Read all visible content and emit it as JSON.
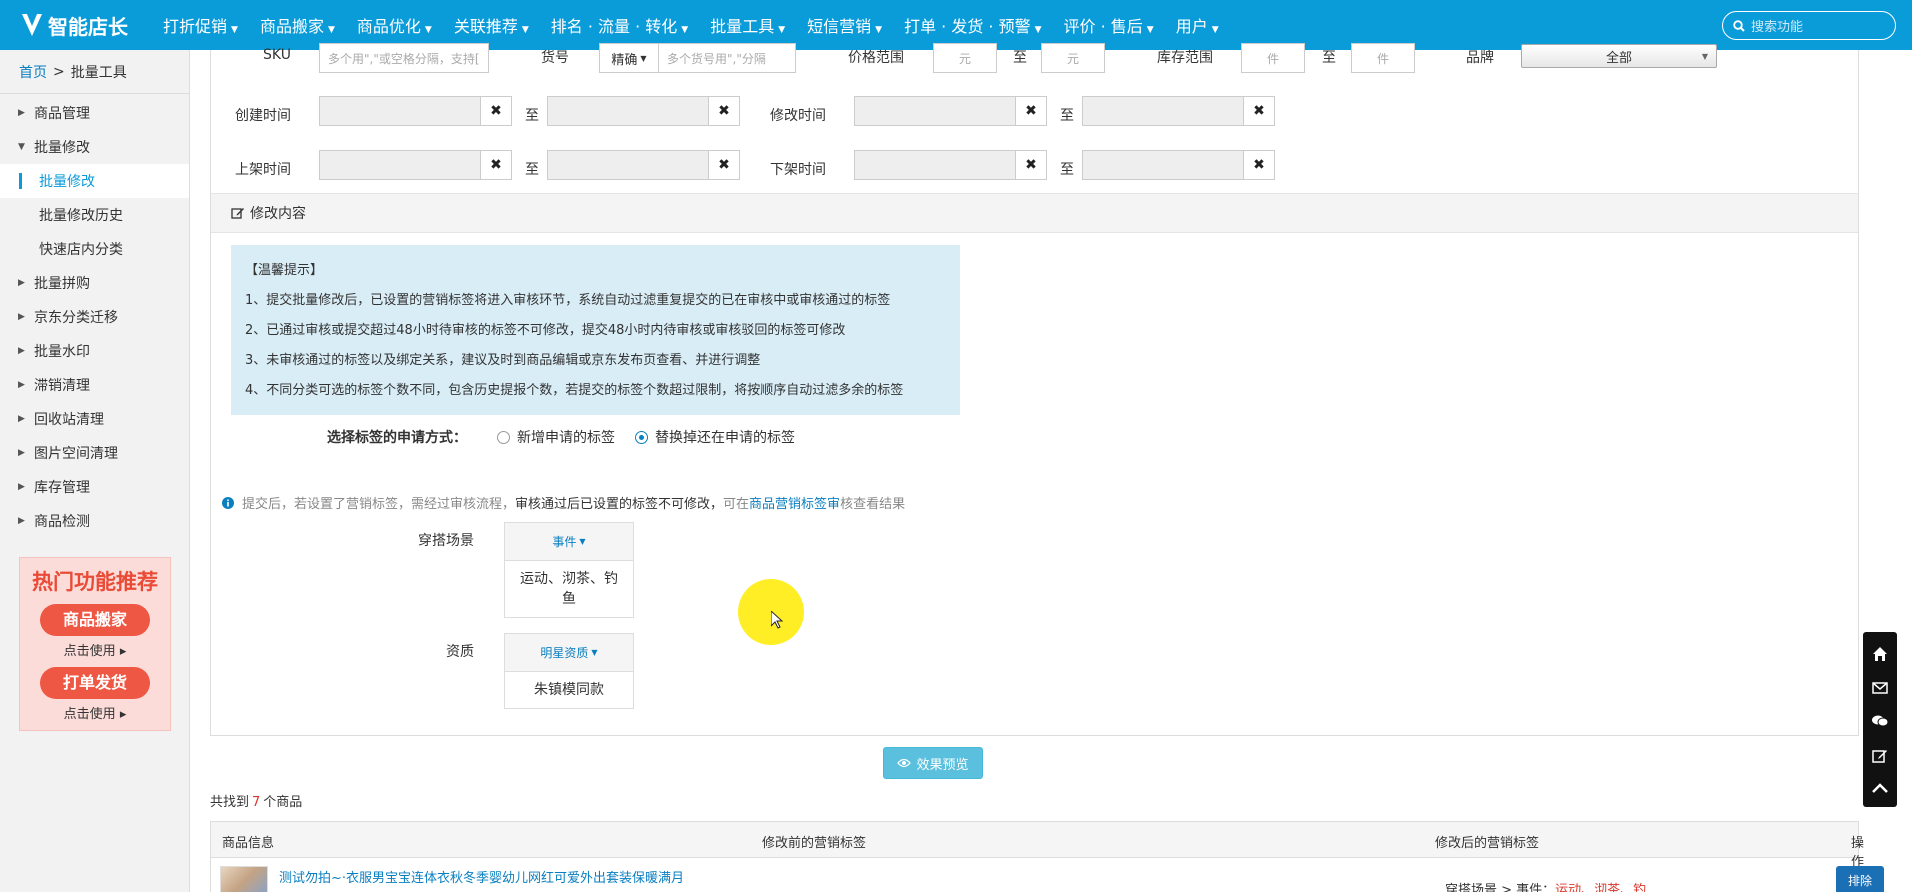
{
  "brand": {
    "name": "智能店长"
  },
  "nav": [
    "打折促销",
    "商品搬家",
    "商品优化",
    "关联推荐",
    "排名 · 流量 · 转化",
    "批量工具",
    "短信营销",
    "打单 · 发货 · 预警",
    "评价 · 售后",
    "用户"
  ],
  "search": {
    "placeholder": "搜索功能"
  },
  "breadcrumb": {
    "home": "首页",
    "sep": ">",
    "current": "批量工具"
  },
  "sidebar": {
    "items": [
      {
        "label": "商品管理"
      },
      {
        "label": "批量修改"
      },
      {
        "label": "批量修改"
      },
      {
        "label": "批量修改历史"
      },
      {
        "label": "快速店内分类"
      },
      {
        "label": "批量拼购"
      },
      {
        "label": "京东分类迁移"
      },
      {
        "label": "批量水印"
      },
      {
        "label": "滞销清理"
      },
      {
        "label": "回收站清理"
      },
      {
        "label": "图片空间清理"
      },
      {
        "label": "库存管理"
      },
      {
        "label": "商品检测"
      }
    ]
  },
  "promo": {
    "title": "热门功能推荐",
    "btn1": "商品搬家",
    "use1": "点击使用",
    "btn2": "打单发货",
    "use2": "点击使用"
  },
  "filters": {
    "sku_label": "SKU",
    "sku_placeholder": "多个用\",\"或空格分隔，支持[",
    "huohao_label": "货号",
    "huohao_mode": "精确",
    "huohao_placeholder": "多个货号用\",\"分隔",
    "price_label": "价格范围",
    "price_unit": "元",
    "to": "至",
    "stock_label": "库存范围",
    "stock_unit": "件",
    "brand_label": "品牌",
    "brand_value": "全部",
    "create_label": "创建时间",
    "modify_label": "修改时间",
    "up_label": "上架时间",
    "down_label": "下架时间"
  },
  "section": {
    "title": "修改内容"
  },
  "tips": [
    "【温馨提示】",
    "1、提交批量修改后，已设置的营销标签将进入审核环节，系统自动过滤重复提交的已在审核中或审核通过的标签",
    "2、已通过审核或提交超过48小时待审核的标签不可修改，提交48小时内待审核或审核驳回的标签可修改",
    "3、未审核通过的标签以及绑定关系，建议及时到商品编辑或京东发布页查看、并进行调整",
    "4、不同分类可选的标签个数不同，包含历史提报个数，若提交的标签个数超过限制，将按顺序自动过滤多余的标签"
  ],
  "apply": {
    "label": "选择标签的申请方式：",
    "opt1": "新增申请的标签",
    "opt2": "替换掉还在申请的标签"
  },
  "info": {
    "t1": "提交后，若设置了营销标签，需经过审核流程，",
    "t2": "审核通过后已设置的标签不可修改，",
    "t3": "可在",
    "link": "商品营销标签审",
    "t4": "核查看结果"
  },
  "tags": [
    {
      "label": "穿搭场景",
      "dropdown": "事件",
      "value": "运动、沏茶、钓鱼"
    },
    {
      "label": "资质",
      "dropdown": "明星资质",
      "value": "朱镇模同款"
    }
  ],
  "preview_btn": "效果预览",
  "found": {
    "pre": "共找到",
    "count": "7",
    "post": "个商品"
  },
  "table": {
    "headers": [
      "商品信息",
      "修改前的营销标签",
      "修改后的营销标签",
      "操作"
    ],
    "row": {
      "title": "测试勿拍~·衣服男宝宝连体衣秋冬季婴幼儿网红可爱外出套装保暖满月",
      "after_prefix": "穿搭场景 > 事件：",
      "after_tags": "运动、沏茶、钓",
      "action": "排除"
    }
  },
  "colors": {
    "brand": "#0a9bd9",
    "tip_bg": "#d9edf7",
    "promo_red": "#ee5743"
  }
}
